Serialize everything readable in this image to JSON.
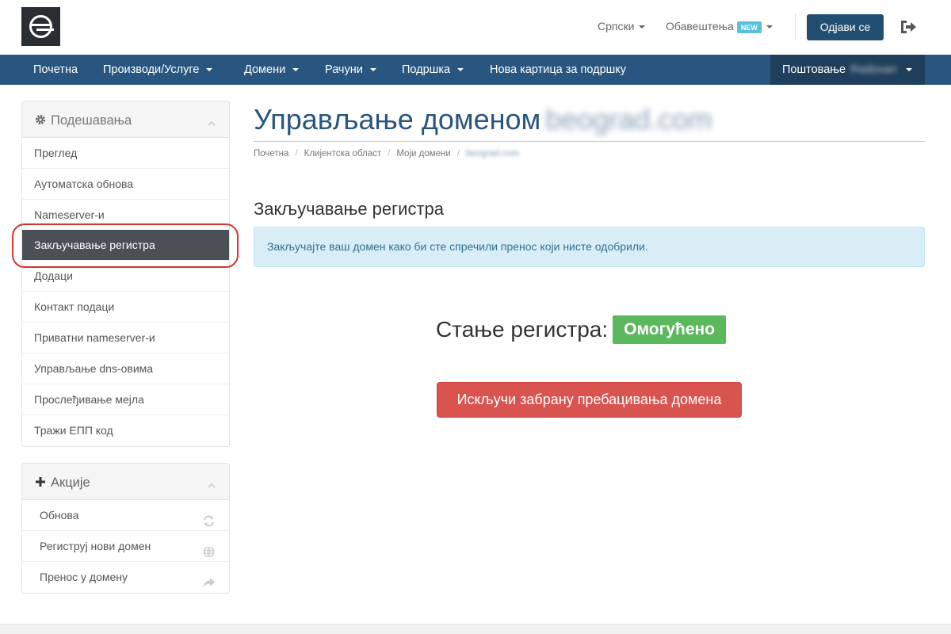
{
  "header": {
    "language": "Српски",
    "notifications": "Обавештења",
    "new_badge": "NEW",
    "logout_label": "Одјави се"
  },
  "navbar": {
    "items": [
      "Почетна",
      "Производи/Услуге",
      "Домени",
      "Рачуни",
      "Подршка",
      "Нова картица за подршку"
    ],
    "account_greeting": "Поштовање",
    "account_name": "Radovan"
  },
  "sidebar": {
    "settings_title": "Подешавања",
    "settings_items": [
      "Преглед",
      "Аутоматска обнова",
      "Nameserver-и",
      "Закључавање регистра",
      "Додаци",
      "Контакт подаци",
      "Приватни nameserver-и",
      "Управљање dns-овима",
      "Прослеђивање мејла",
      "Тражи ЕПП код"
    ],
    "active_index": 3,
    "actions_title": "Акције",
    "action_items": [
      "Обнова",
      "Региструј нови домен",
      "Пренос у домену"
    ]
  },
  "main": {
    "title": "Управљање доменом",
    "domain": "beograd.com",
    "breadcrumb": [
      "Почетна",
      "Клијентска област",
      "Моји домени",
      "beograd.com"
    ],
    "section_title": "Закључавање регистра",
    "alert": "Закључајте ваш домен како би сте спречили пренос који нисте одобрили.",
    "status_label": "Стање регистра:",
    "status_value": "Омогућено",
    "unlock_button": "Искључи забрану пребацивања домена"
  },
  "colors": {
    "brand": "#285680",
    "status_success": "#5cb85c",
    "danger_button": "#d9534f",
    "alert_bg": "#d9edf7"
  }
}
